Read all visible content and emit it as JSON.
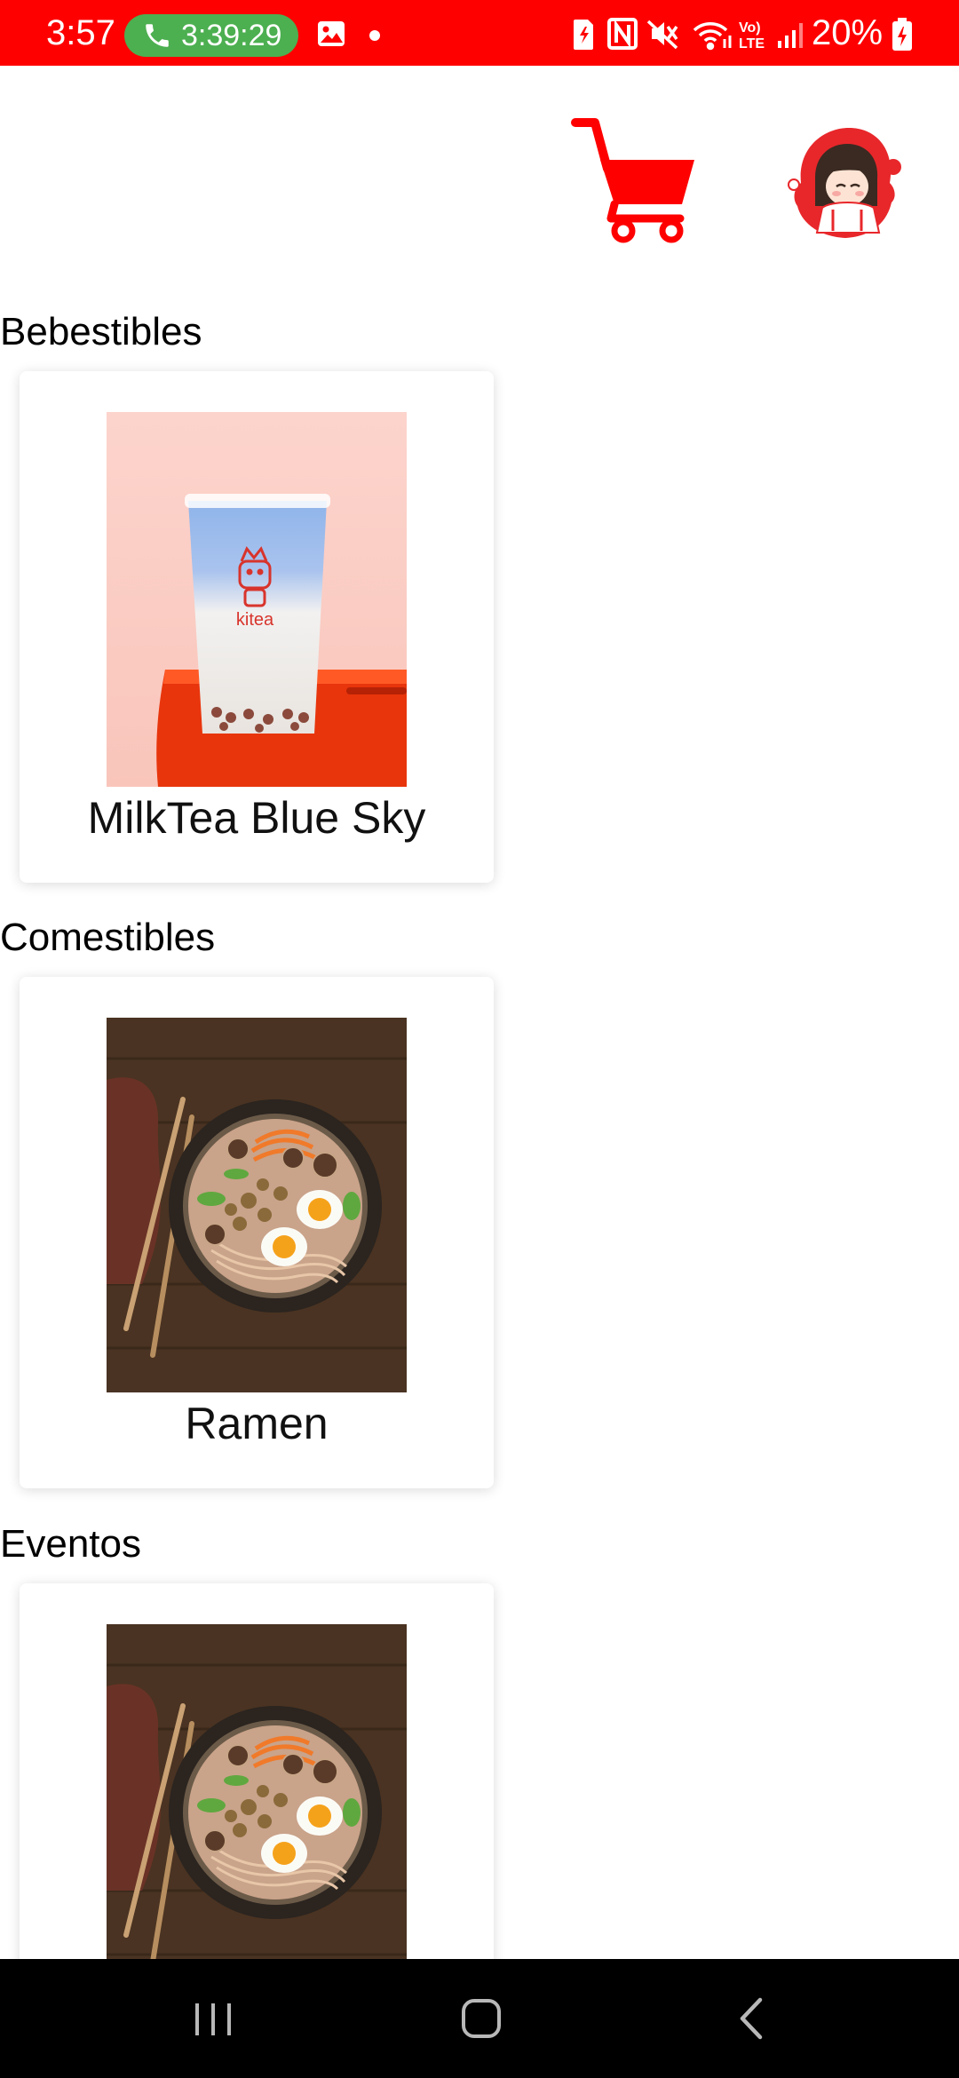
{
  "status_bar": {
    "time": "3:57",
    "call_timer": "3:39:29",
    "battery": "20%",
    "background_color": "#ff0000",
    "call_pill_color": "#4caf50",
    "icons": [
      "phone-icon",
      "gallery-icon",
      "notification-dot",
      "sim-icon",
      "nfc-icon",
      "mute-icon",
      "wifi-icon",
      "volte-icon",
      "signal-icon",
      "battery-icon"
    ]
  },
  "header": {
    "cart_icon": "cart-icon",
    "avatar_icon": "avatar",
    "accent_color": "#ff0000"
  },
  "sections": [
    {
      "title": "Bebestibles",
      "items": [
        {
          "label": "MilkTea Blue Sky",
          "image": "milk-tea-image"
        }
      ]
    },
    {
      "title": "Comestibles",
      "items": [
        {
          "label": "Ramen",
          "image": "ramen-image"
        }
      ]
    },
    {
      "title": "Eventos",
      "items": [
        {
          "label": "",
          "image": "ramen-image"
        }
      ]
    }
  ],
  "nav_bar": {
    "buttons": [
      "recent-apps-icon",
      "home-icon",
      "back-icon"
    ]
  }
}
